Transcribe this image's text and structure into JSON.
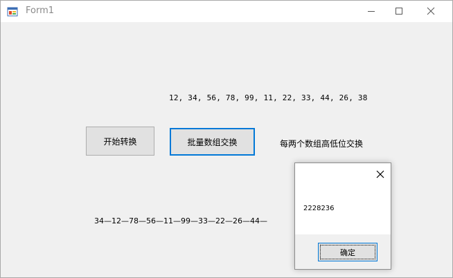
{
  "window": {
    "title": "Form1",
    "icon": "winforms-app-icon"
  },
  "titlebar_buttons": {
    "minimize_icon": "minimize-icon",
    "maximize_icon": "maximize-icon",
    "close_icon": "close-icon"
  },
  "labels": {
    "numbers": "12, 34, 56, 78, 99, 11, 22, 33, 44, 26, 38",
    "description": "每两个数组高低位交换",
    "result": "34—12—78—56—11—99—33—22—26—44—"
  },
  "buttons": {
    "start": "开始转换",
    "batch": "批量数组交换"
  },
  "message_box": {
    "text": "2228236",
    "ok_label": "确定",
    "close_icon": "close-icon"
  },
  "colors": {
    "focus_border": "#0078d7",
    "form_background": "#f0f0f0",
    "button_face": "#e1e1e1"
  }
}
